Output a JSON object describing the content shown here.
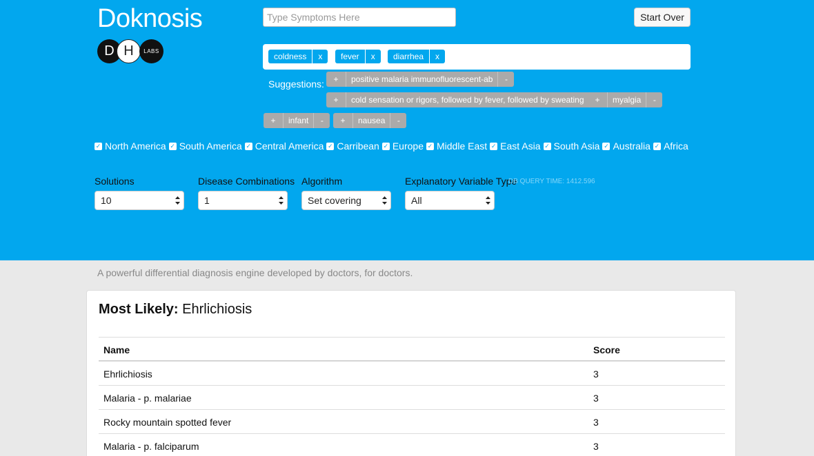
{
  "app": {
    "title": "Doknosis",
    "logo_d": "D",
    "logo_h": "H",
    "logo_labs": "LABS"
  },
  "search": {
    "placeholder": "Type Symptoms Here"
  },
  "start_over_label": "Start Over",
  "symptoms": [
    {
      "label": "coldness",
      "remove": "x"
    },
    {
      "label": "fever",
      "remove": "x"
    },
    {
      "label": "diarrhea",
      "remove": "x"
    }
  ],
  "suggestions_label": "Suggestions:",
  "suggestions": [
    {
      "plus": "+",
      "label": "positive malaria immunofluorescent-ab",
      "minus": "-"
    },
    {
      "plus": "+",
      "label": "cold sensation or rigors, followed by fever, followed by sweating",
      "minus": "-"
    },
    {
      "plus": "+",
      "label": "myalgia",
      "minus": "-"
    },
    {
      "plus": "+",
      "label": "infant",
      "minus": "-"
    },
    {
      "plus": "+",
      "label": "nausea",
      "minus": "-"
    }
  ],
  "regions": [
    "North America",
    "South America",
    "Central America",
    "Carribean",
    "Europe",
    "Middle East",
    "East Asia",
    "South Asia",
    "Australia",
    "Africa"
  ],
  "controls": {
    "solutions": {
      "label": "Solutions",
      "value": "10"
    },
    "combinations": {
      "label": "Disease Combinations",
      "value": "1"
    },
    "algorithm": {
      "label": "Algorithm",
      "value": "Set covering"
    },
    "variable_type": {
      "label": "Explanatory Variable Type",
      "value": "All"
    },
    "db_time": "DB QUERY TIME: 1412.596"
  },
  "tagline": "A powerful differential diagnosis engine developed by doctors, for doctors.",
  "results": {
    "most_likely_prefix": "Most Likely:",
    "most_likely": "Ehrlichiosis",
    "columns": [
      "Name",
      "Score"
    ],
    "rows": [
      {
        "name": "Ehrlichiosis",
        "score": "3"
      },
      {
        "name": "Malaria - p. malariae",
        "score": "3"
      },
      {
        "name": "Rocky mountain spotted fever",
        "score": "3"
      },
      {
        "name": "Malaria - p. falciparum",
        "score": "3"
      }
    ]
  }
}
